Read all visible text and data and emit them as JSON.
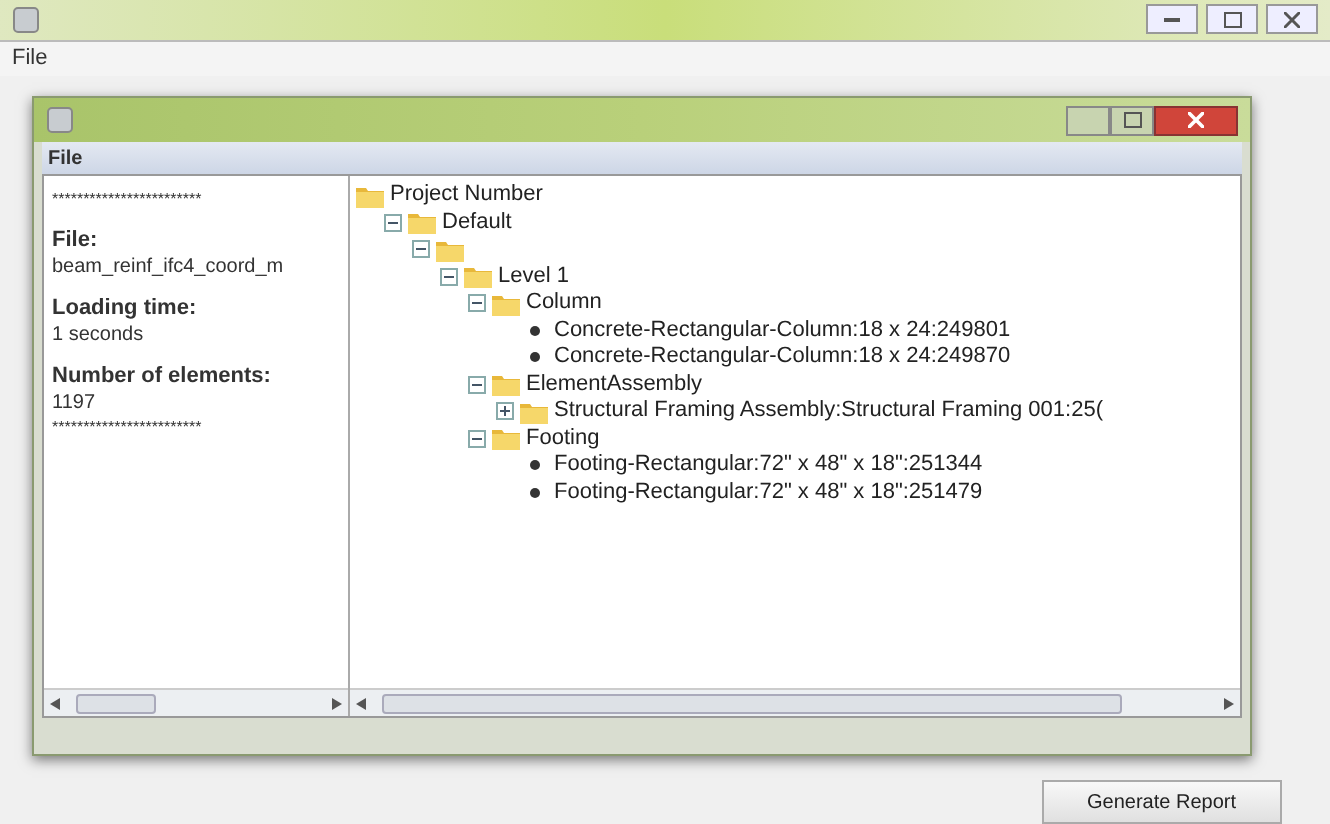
{
  "window": {
    "menu": [
      "File"
    ],
    "button": "Generate Report"
  },
  "dialog": {
    "menu": [
      "File"
    ],
    "info": [
      {
        "kind": "rule",
        "text": "************************"
      },
      {
        "kind": "label",
        "text": "File:"
      },
      {
        "kind": "value",
        "text": "beam_reinf_ifc4_coord_m"
      },
      {
        "kind": "label",
        "text": "Loading time:"
      },
      {
        "kind": "value",
        "text": "1 seconds"
      },
      {
        "kind": "label",
        "text": "Number of elements:"
      },
      {
        "kind": "value",
        "text": "1197"
      },
      {
        "kind": "rule",
        "text": "************************"
      }
    ],
    "tree": [
      {
        "kind": "folder",
        "label": "Project Number",
        "children": [
          {
            "kind": "folder",
            "label": "Default",
            "expanded": true,
            "children": [
              {
                "kind": "folder",
                "expanded": true,
                "children": [
                  {
                    "kind": "folder",
                    "label": "Level 1",
                    "expanded": true,
                    "children": [
                      {
                        "kind": "folder",
                        "label": "Column",
                        "expanded": true,
                        "children": [
                          {
                            "kind": "leaf",
                            "label": "Concrete-Rectangular-Column:18 x 24:249801"
                          },
                          {
                            "kind": "leaf",
                            "label": "Concrete-Rectangular-Column:18 x 24:249870"
                          }
                        ]
                      },
                      {
                        "kind": "folder",
                        "label": "ElementAssembly",
                        "expanded": true,
                        "children": [
                          {
                            "kind": "folder",
                            "label": "Structural Framing Assembly:Structural Framing 001:25(",
                            "expanded": false
                          }
                        ]
                      },
                      {
                        "kind": "folder",
                        "label": "Footing",
                        "expanded": true,
                        "children": [
                          {
                            "kind": "leaf",
                            "label": "Footing-Rectangular:72\" x 48\" x 18\":251344"
                          },
                          {
                            "kind": "leaf",
                            "label": "Footing-Rectangular:72\" x 48\" x 18\":251479"
                          }
                        ]
                      }
                    ]
                  }
                ]
              }
            ]
          }
        ]
      }
    ]
  }
}
